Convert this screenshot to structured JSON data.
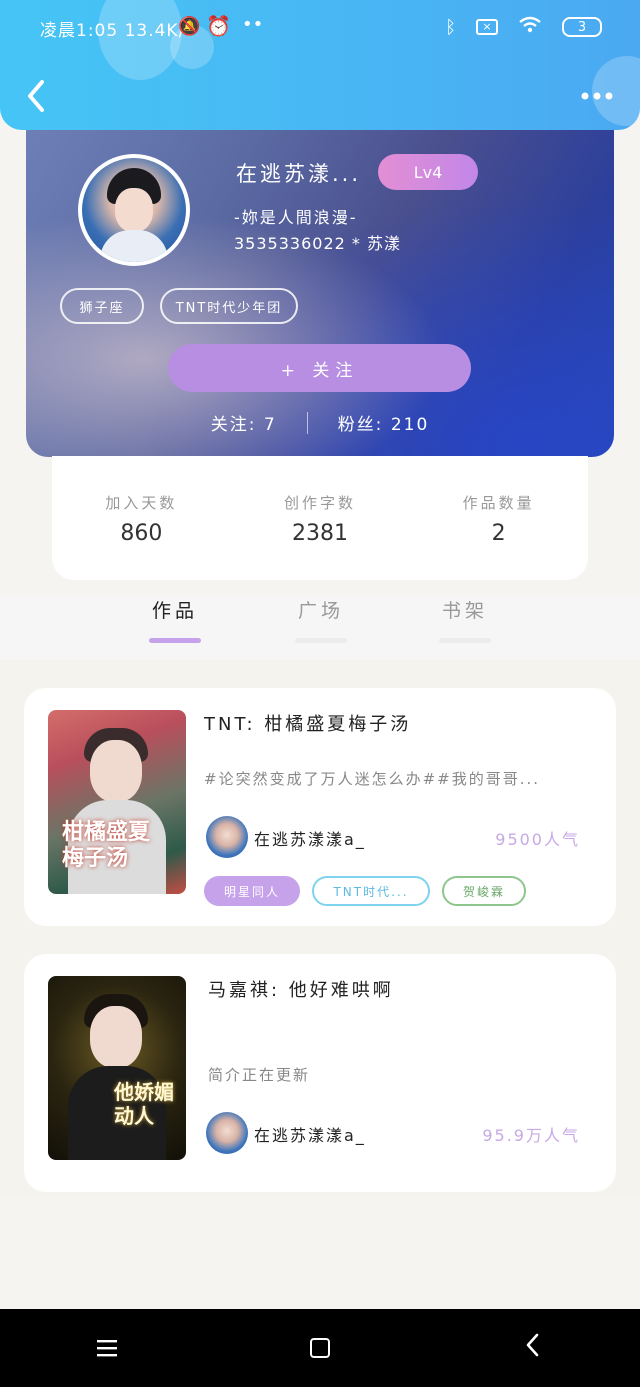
{
  "status_bar": {
    "left_text": "凌晨1:05 13.4K/s",
    "right_battery": "3",
    "icons": [
      "mute-icon",
      "alarm-icon",
      "more-dots-icon",
      "bluetooth-icon",
      "sim-off-icon",
      "wifi-icon",
      "battery-icon"
    ]
  },
  "header": {
    "back_icon": "chevron-left-icon",
    "more_icon": "more-horizontal-icon"
  },
  "profile": {
    "username": "在逃苏漾...",
    "level": "Lv4",
    "signature": "-妳是人間浪漫-",
    "uid": "3535336022 * 苏漾",
    "tags": [
      "狮子座",
      "TNT时代少年团"
    ],
    "follow_button": "+  关注",
    "following_label": "关注:",
    "following_count": "7",
    "fans_label": "粉丝:",
    "fans_count": "210"
  },
  "stats": [
    {
      "label": "加入天数",
      "value": "860"
    },
    {
      "label": "创作字数",
      "value": "2381"
    },
    {
      "label": "作品数量",
      "value": "2"
    }
  ],
  "tabs": [
    {
      "label": "作品",
      "active": true
    },
    {
      "label": "广场",
      "active": false
    },
    {
      "label": "书架",
      "active": false
    }
  ],
  "works": [
    {
      "title": "TNT:  柑橘盛夏梅子汤",
      "description": "#论突然变成了万人迷怎么办##我的哥哥...",
      "author": "在逃苏漾漾a_",
      "popularity": "9500人气",
      "cover_text": "柑橘盛夏梅子汤",
      "chips": [
        "明星同人",
        "TNT时代...",
        "贺峻霖"
      ]
    },
    {
      "title": "马嘉祺:  他好难哄啊",
      "description": "简介正在更新",
      "author": "在逃苏漾漾a_",
      "popularity": "95.9万人气",
      "cover_text": "他娇媚动人",
      "chips": []
    }
  ],
  "navbar": {
    "menu_icon": "≡",
    "home_icon": "square-icon",
    "back_icon": "‹"
  },
  "colors": {
    "header_blue": "#45c5f5",
    "accent_purple": "#b78ee2",
    "level_pink": "#e38ed4",
    "popularity_purple": "#c7a9e4"
  }
}
